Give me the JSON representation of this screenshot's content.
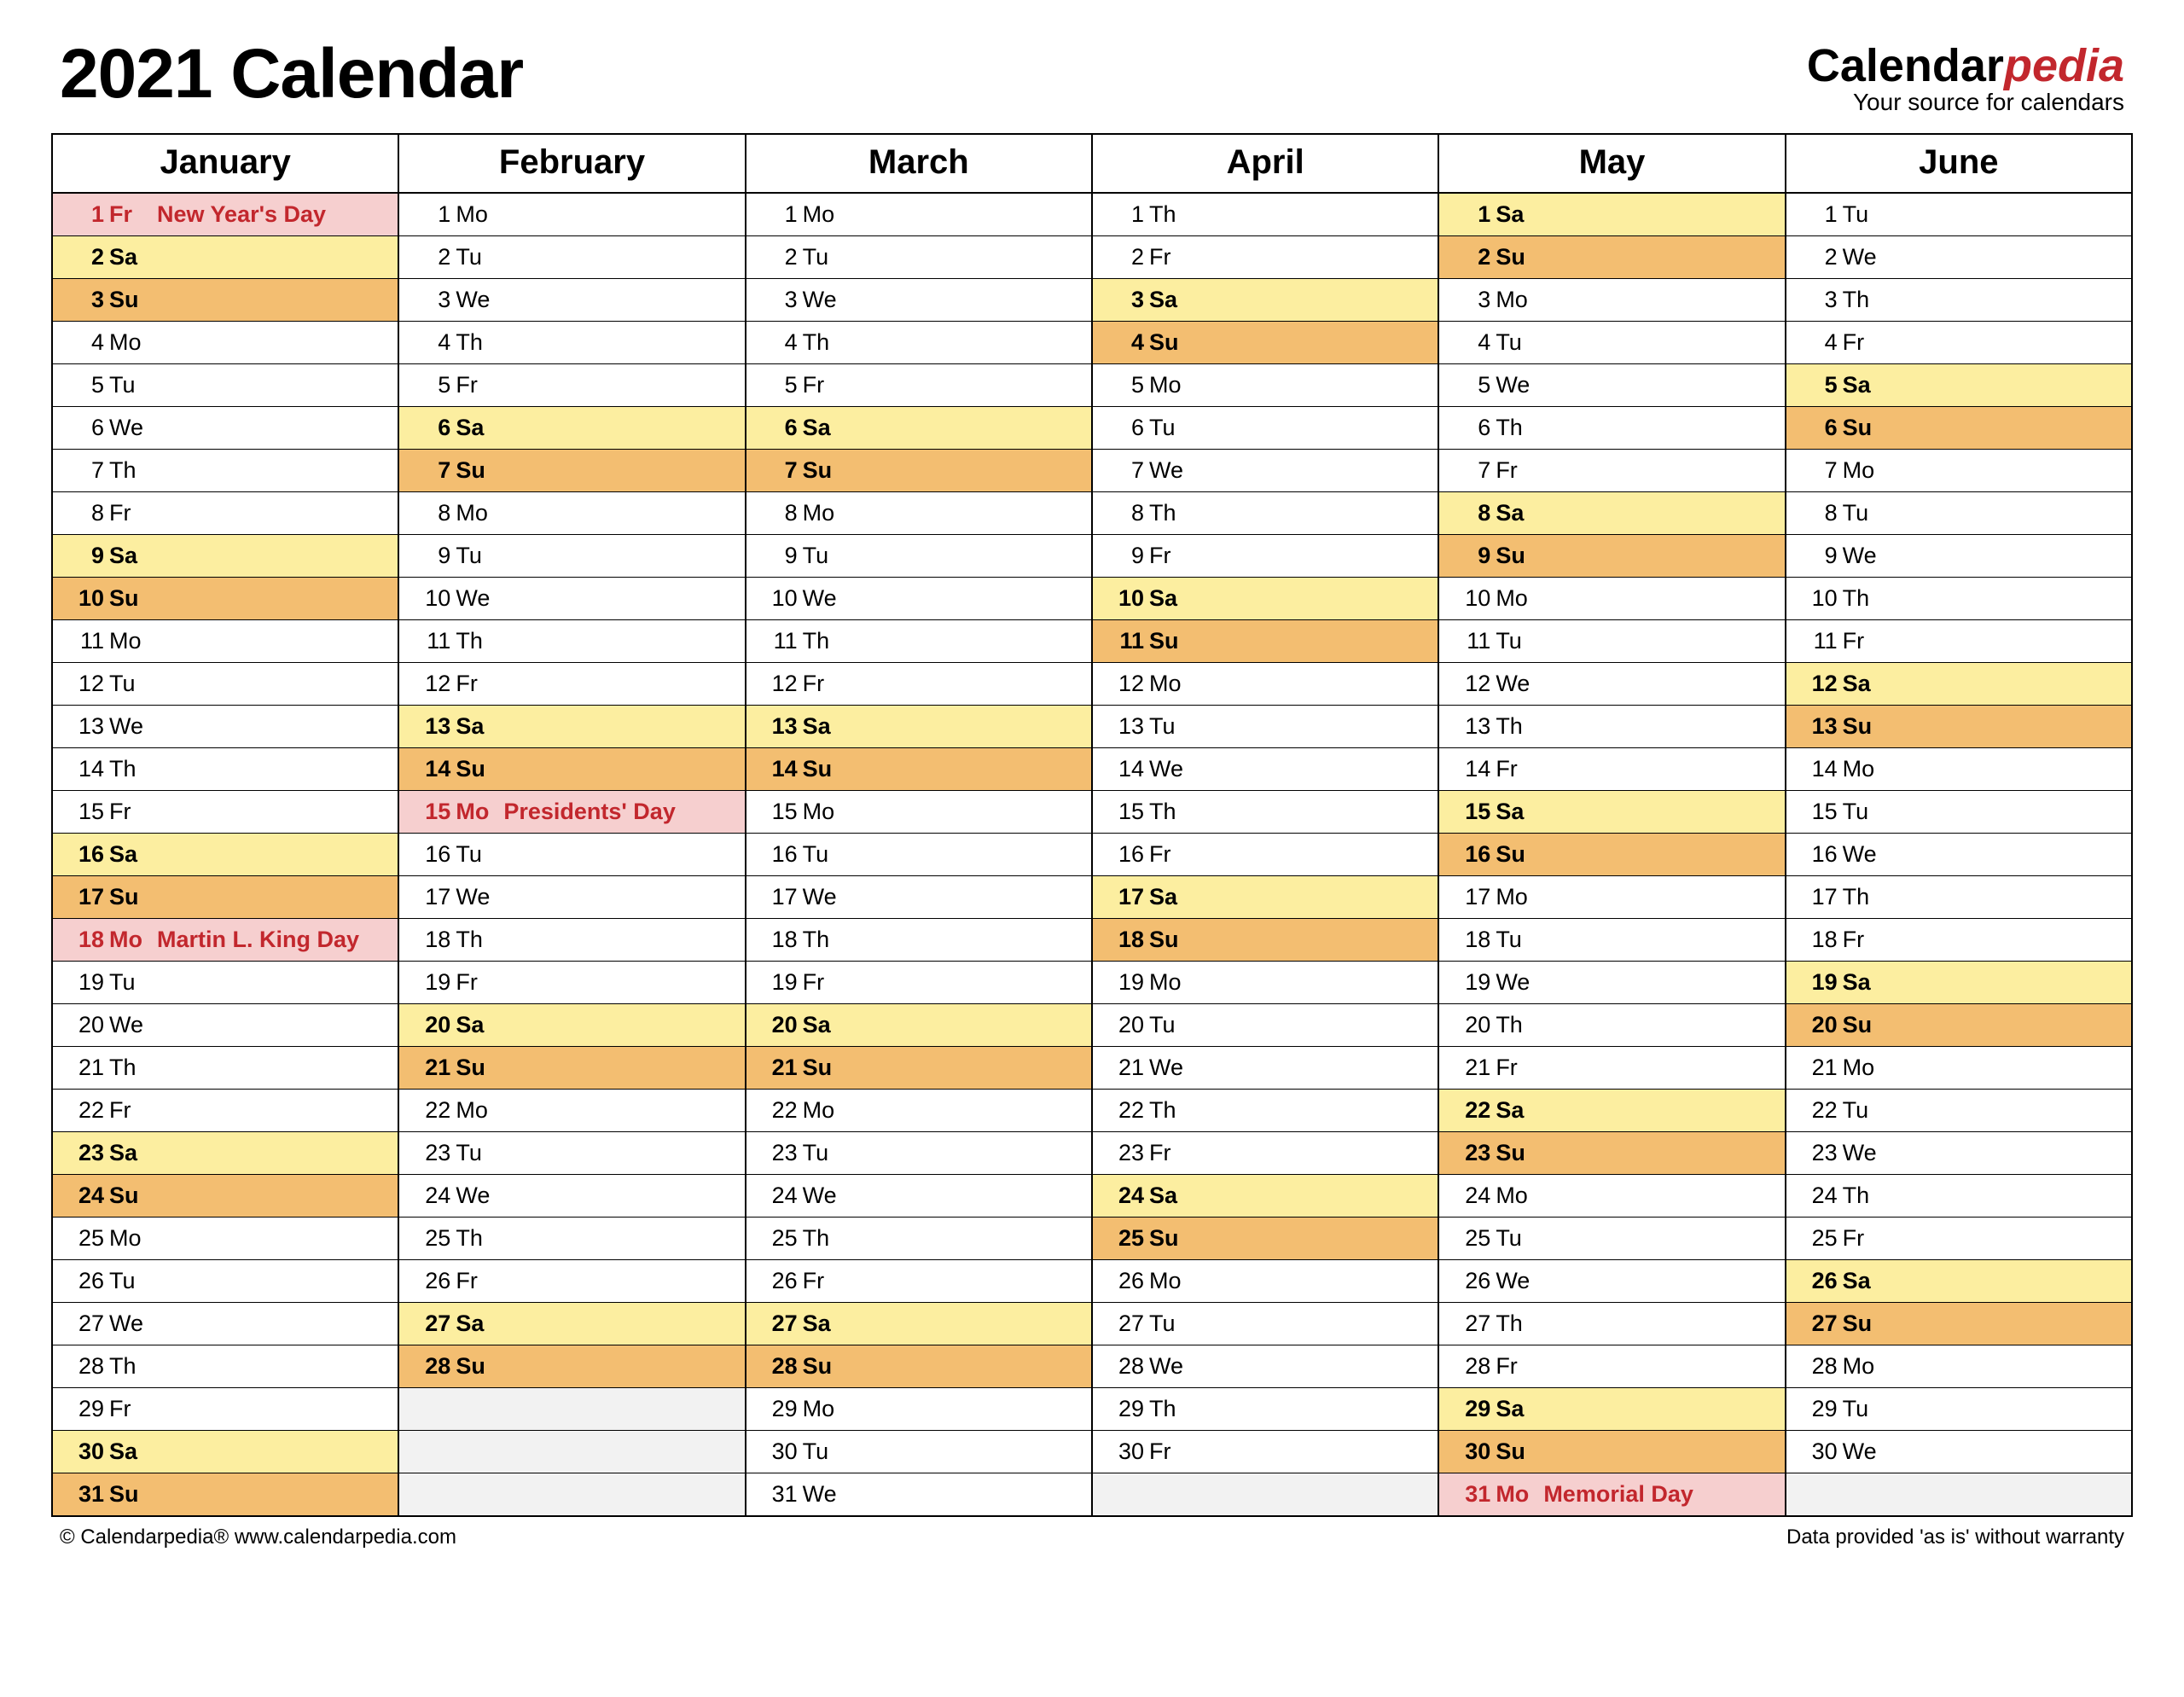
{
  "header": {
    "title": "2021 Calendar",
    "logo_prefix": "Calendar",
    "logo_accent": "pedia",
    "logo_sub": "Your source for calendars"
  },
  "footer": {
    "left": "© Calendarpedia®   www.calendarpedia.com",
    "right": "Data provided 'as is' without warranty"
  },
  "months": [
    "January",
    "February",
    "March",
    "April",
    "May",
    "June"
  ],
  "days": {
    "January": [
      [
        "1",
        "Fr",
        "New Year's Day",
        "hol"
      ],
      [
        "2",
        "Sa",
        "",
        "sat"
      ],
      [
        "3",
        "Su",
        "",
        "sun"
      ],
      [
        "4",
        "Mo",
        "",
        ""
      ],
      [
        "5",
        "Tu",
        "",
        ""
      ],
      [
        "6",
        "We",
        "",
        ""
      ],
      [
        "7",
        "Th",
        "",
        ""
      ],
      [
        "8",
        "Fr",
        "",
        ""
      ],
      [
        "9",
        "Sa",
        "",
        "sat"
      ],
      [
        "10",
        "Su",
        "",
        "sun"
      ],
      [
        "11",
        "Mo",
        "",
        ""
      ],
      [
        "12",
        "Tu",
        "",
        ""
      ],
      [
        "13",
        "We",
        "",
        ""
      ],
      [
        "14",
        "Th",
        "",
        ""
      ],
      [
        "15",
        "Fr",
        "",
        ""
      ],
      [
        "16",
        "Sa",
        "",
        "sat"
      ],
      [
        "17",
        "Su",
        "",
        "sun"
      ],
      [
        "18",
        "Mo",
        "Martin L. King Day",
        "hol"
      ],
      [
        "19",
        "Tu",
        "",
        ""
      ],
      [
        "20",
        "We",
        "",
        ""
      ],
      [
        "21",
        "Th",
        "",
        ""
      ],
      [
        "22",
        "Fr",
        "",
        ""
      ],
      [
        "23",
        "Sa",
        "",
        "sat"
      ],
      [
        "24",
        "Su",
        "",
        "sun"
      ],
      [
        "25",
        "Mo",
        "",
        ""
      ],
      [
        "26",
        "Tu",
        "",
        ""
      ],
      [
        "27",
        "We",
        "",
        ""
      ],
      [
        "28",
        "Th",
        "",
        ""
      ],
      [
        "29",
        "Fr",
        "",
        ""
      ],
      [
        "30",
        "Sa",
        "",
        "sat"
      ],
      [
        "31",
        "Su",
        "",
        "sun"
      ]
    ],
    "February": [
      [
        "1",
        "Mo",
        "",
        ""
      ],
      [
        "2",
        "Tu",
        "",
        ""
      ],
      [
        "3",
        "We",
        "",
        ""
      ],
      [
        "4",
        "Th",
        "",
        ""
      ],
      [
        "5",
        "Fr",
        "",
        ""
      ],
      [
        "6",
        "Sa",
        "",
        "sat"
      ],
      [
        "7",
        "Su",
        "",
        "sun"
      ],
      [
        "8",
        "Mo",
        "",
        ""
      ],
      [
        "9",
        "Tu",
        "",
        ""
      ],
      [
        "10",
        "We",
        "",
        ""
      ],
      [
        "11",
        "Th",
        "",
        ""
      ],
      [
        "12",
        "Fr",
        "",
        ""
      ],
      [
        "13",
        "Sa",
        "",
        "sat"
      ],
      [
        "14",
        "Su",
        "",
        "sun"
      ],
      [
        "15",
        "Mo",
        "Presidents' Day",
        "hol"
      ],
      [
        "16",
        "Tu",
        "",
        ""
      ],
      [
        "17",
        "We",
        "",
        ""
      ],
      [
        "18",
        "Th",
        "",
        ""
      ],
      [
        "19",
        "Fr",
        "",
        ""
      ],
      [
        "20",
        "Sa",
        "",
        "sat"
      ],
      [
        "21",
        "Su",
        "",
        "sun"
      ],
      [
        "22",
        "Mo",
        "",
        ""
      ],
      [
        "23",
        "Tu",
        "",
        ""
      ],
      [
        "24",
        "We",
        "",
        ""
      ],
      [
        "25",
        "Th",
        "",
        ""
      ],
      [
        "26",
        "Fr",
        "",
        ""
      ],
      [
        "27",
        "Sa",
        "",
        "sat"
      ],
      [
        "28",
        "Su",
        "",
        "sun"
      ],
      [
        "",
        "",
        "",
        "empty"
      ],
      [
        "",
        "",
        "",
        "empty"
      ],
      [
        "",
        "",
        "",
        "empty"
      ]
    ],
    "March": [
      [
        "1",
        "Mo",
        "",
        ""
      ],
      [
        "2",
        "Tu",
        "",
        ""
      ],
      [
        "3",
        "We",
        "",
        ""
      ],
      [
        "4",
        "Th",
        "",
        ""
      ],
      [
        "5",
        "Fr",
        "",
        ""
      ],
      [
        "6",
        "Sa",
        "",
        "sat"
      ],
      [
        "7",
        "Su",
        "",
        "sun"
      ],
      [
        "8",
        "Mo",
        "",
        ""
      ],
      [
        "9",
        "Tu",
        "",
        ""
      ],
      [
        "10",
        "We",
        "",
        ""
      ],
      [
        "11",
        "Th",
        "",
        ""
      ],
      [
        "12",
        "Fr",
        "",
        ""
      ],
      [
        "13",
        "Sa",
        "",
        "sat"
      ],
      [
        "14",
        "Su",
        "",
        "sun"
      ],
      [
        "15",
        "Mo",
        "",
        ""
      ],
      [
        "16",
        "Tu",
        "",
        ""
      ],
      [
        "17",
        "We",
        "",
        ""
      ],
      [
        "18",
        "Th",
        "",
        ""
      ],
      [
        "19",
        "Fr",
        "",
        ""
      ],
      [
        "20",
        "Sa",
        "",
        "sat"
      ],
      [
        "21",
        "Su",
        "",
        "sun"
      ],
      [
        "22",
        "Mo",
        "",
        ""
      ],
      [
        "23",
        "Tu",
        "",
        ""
      ],
      [
        "24",
        "We",
        "",
        ""
      ],
      [
        "25",
        "Th",
        "",
        ""
      ],
      [
        "26",
        "Fr",
        "",
        ""
      ],
      [
        "27",
        "Sa",
        "",
        "sat"
      ],
      [
        "28",
        "Su",
        "",
        "sun"
      ],
      [
        "29",
        "Mo",
        "",
        ""
      ],
      [
        "30",
        "Tu",
        "",
        ""
      ],
      [
        "31",
        "We",
        "",
        ""
      ]
    ],
    "April": [
      [
        "1",
        "Th",
        "",
        ""
      ],
      [
        "2",
        "Fr",
        "",
        ""
      ],
      [
        "3",
        "Sa",
        "",
        "sat"
      ],
      [
        "4",
        "Su",
        "",
        "sun"
      ],
      [
        "5",
        "Mo",
        "",
        ""
      ],
      [
        "6",
        "Tu",
        "",
        ""
      ],
      [
        "7",
        "We",
        "",
        ""
      ],
      [
        "8",
        "Th",
        "",
        ""
      ],
      [
        "9",
        "Fr",
        "",
        ""
      ],
      [
        "10",
        "Sa",
        "",
        "sat"
      ],
      [
        "11",
        "Su",
        "",
        "sun"
      ],
      [
        "12",
        "Mo",
        "",
        ""
      ],
      [
        "13",
        "Tu",
        "",
        ""
      ],
      [
        "14",
        "We",
        "",
        ""
      ],
      [
        "15",
        "Th",
        "",
        ""
      ],
      [
        "16",
        "Fr",
        "",
        ""
      ],
      [
        "17",
        "Sa",
        "",
        "sat"
      ],
      [
        "18",
        "Su",
        "",
        "sun"
      ],
      [
        "19",
        "Mo",
        "",
        ""
      ],
      [
        "20",
        "Tu",
        "",
        ""
      ],
      [
        "21",
        "We",
        "",
        ""
      ],
      [
        "22",
        "Th",
        "",
        ""
      ],
      [
        "23",
        "Fr",
        "",
        ""
      ],
      [
        "24",
        "Sa",
        "",
        "sat"
      ],
      [
        "25",
        "Su",
        "",
        "sun"
      ],
      [
        "26",
        "Mo",
        "",
        ""
      ],
      [
        "27",
        "Tu",
        "",
        ""
      ],
      [
        "28",
        "We",
        "",
        ""
      ],
      [
        "29",
        "Th",
        "",
        ""
      ],
      [
        "30",
        "Fr",
        "",
        ""
      ],
      [
        "",
        "",
        "",
        "empty"
      ]
    ],
    "May": [
      [
        "1",
        "Sa",
        "",
        "sat"
      ],
      [
        "2",
        "Su",
        "",
        "sun"
      ],
      [
        "3",
        "Mo",
        "",
        ""
      ],
      [
        "4",
        "Tu",
        "",
        ""
      ],
      [
        "5",
        "We",
        "",
        ""
      ],
      [
        "6",
        "Th",
        "",
        ""
      ],
      [
        "7",
        "Fr",
        "",
        ""
      ],
      [
        "8",
        "Sa",
        "",
        "sat"
      ],
      [
        "9",
        "Su",
        "",
        "sun"
      ],
      [
        "10",
        "Mo",
        "",
        ""
      ],
      [
        "11",
        "Tu",
        "",
        ""
      ],
      [
        "12",
        "We",
        "",
        ""
      ],
      [
        "13",
        "Th",
        "",
        ""
      ],
      [
        "14",
        "Fr",
        "",
        ""
      ],
      [
        "15",
        "Sa",
        "",
        "sat"
      ],
      [
        "16",
        "Su",
        "",
        "sun"
      ],
      [
        "17",
        "Mo",
        "",
        ""
      ],
      [
        "18",
        "Tu",
        "",
        ""
      ],
      [
        "19",
        "We",
        "",
        ""
      ],
      [
        "20",
        "Th",
        "",
        ""
      ],
      [
        "21",
        "Fr",
        "",
        ""
      ],
      [
        "22",
        "Sa",
        "",
        "sat"
      ],
      [
        "23",
        "Su",
        "",
        "sun"
      ],
      [
        "24",
        "Mo",
        "",
        ""
      ],
      [
        "25",
        "Tu",
        "",
        ""
      ],
      [
        "26",
        "We",
        "",
        ""
      ],
      [
        "27",
        "Th",
        "",
        ""
      ],
      [
        "28",
        "Fr",
        "",
        ""
      ],
      [
        "29",
        "Sa",
        "",
        "sat"
      ],
      [
        "30",
        "Su",
        "",
        "sun"
      ],
      [
        "31",
        "Mo",
        "Memorial Day",
        "hol"
      ]
    ],
    "June": [
      [
        "1",
        "Tu",
        "",
        ""
      ],
      [
        "2",
        "We",
        "",
        ""
      ],
      [
        "3",
        "Th",
        "",
        ""
      ],
      [
        "4",
        "Fr",
        "",
        ""
      ],
      [
        "5",
        "Sa",
        "",
        "sat"
      ],
      [
        "6",
        "Su",
        "",
        "sun"
      ],
      [
        "7",
        "Mo",
        "",
        ""
      ],
      [
        "8",
        "Tu",
        "",
        ""
      ],
      [
        "9",
        "We",
        "",
        ""
      ],
      [
        "10",
        "Th",
        "",
        ""
      ],
      [
        "11",
        "Fr",
        "",
        ""
      ],
      [
        "12",
        "Sa",
        "",
        "sat"
      ],
      [
        "13",
        "Su",
        "",
        "sun"
      ],
      [
        "14",
        "Mo",
        "",
        ""
      ],
      [
        "15",
        "Tu",
        "",
        ""
      ],
      [
        "16",
        "We",
        "",
        ""
      ],
      [
        "17",
        "Th",
        "",
        ""
      ],
      [
        "18",
        "Fr",
        "",
        ""
      ],
      [
        "19",
        "Sa",
        "",
        "sat"
      ],
      [
        "20",
        "Su",
        "",
        "sun"
      ],
      [
        "21",
        "Mo",
        "",
        ""
      ],
      [
        "22",
        "Tu",
        "",
        ""
      ],
      [
        "23",
        "We",
        "",
        ""
      ],
      [
        "24",
        "Th",
        "",
        ""
      ],
      [
        "25",
        "Fr",
        "",
        ""
      ],
      [
        "26",
        "Sa",
        "",
        "sat"
      ],
      [
        "27",
        "Su",
        "",
        "sun"
      ],
      [
        "28",
        "Mo",
        "",
        ""
      ],
      [
        "29",
        "Tu",
        "",
        ""
      ],
      [
        "30",
        "We",
        "",
        ""
      ],
      [
        "",
        "",
        "",
        "empty"
      ]
    ]
  }
}
